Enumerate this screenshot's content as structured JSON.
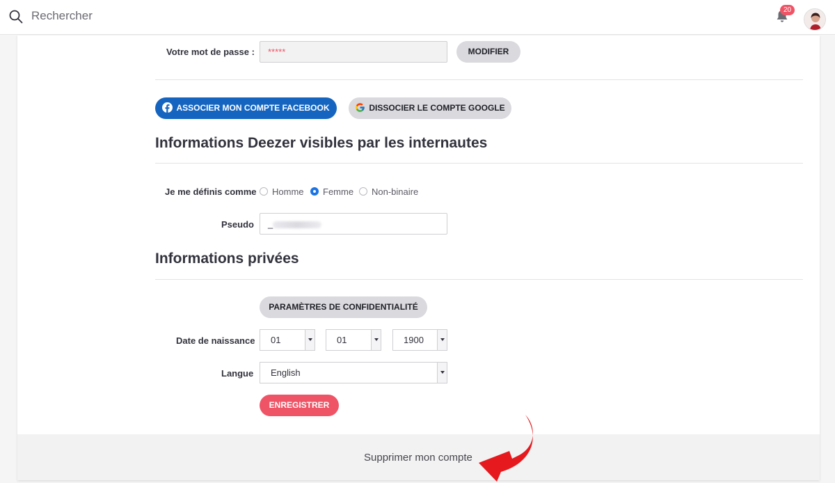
{
  "topbar": {
    "search_placeholder": "Rechercher",
    "notifications_count": "20"
  },
  "password": {
    "label": "Votre mot de passe :",
    "value": "*****",
    "modify_label": "MODIFIER"
  },
  "social": {
    "facebook_label": "ASSOCIER MON COMPTE FACEBOOK",
    "google_label": "DISSOCIER LE COMPTE GOOGLE"
  },
  "public_info": {
    "title": "Informations Deezer visibles par les internautes",
    "gender_label": "Je me définis comme",
    "gender_options": [
      "Homme",
      "Femme",
      "Non-binaire"
    ],
    "gender_selected": "Femme",
    "pseudo_label": "Pseudo",
    "pseudo_prefix": "_"
  },
  "private_info": {
    "title": "Informations privées",
    "privacy_button": "PARAMÈTRES DE CONFIDENTIALITÉ",
    "birth_label": "Date de naissance",
    "birth_day": "01",
    "birth_month": "01",
    "birth_year": "1900",
    "language_label": "Langue",
    "language_value": "English",
    "save_button": "ENREGISTRER"
  },
  "footer": {
    "delete_label": "Supprimer mon compte"
  },
  "colors": {
    "accent": "#ef5466",
    "facebook": "#1565c0",
    "radio_selected": "#1b74e4",
    "annotation_arrow": "#e5191e"
  }
}
